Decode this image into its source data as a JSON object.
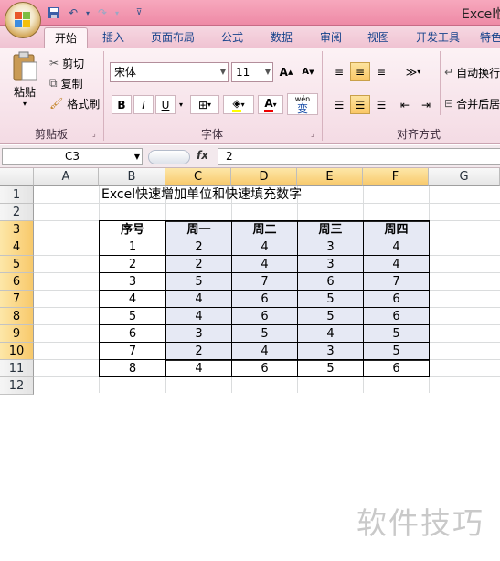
{
  "window": {
    "title": "Excel快"
  },
  "quick_access": {
    "icons": [
      "save-icon",
      "undo-icon",
      "redo-icon",
      "customize-icon"
    ]
  },
  "ribbon": {
    "tabs": [
      "开始",
      "插入",
      "页面布局",
      "公式",
      "数据",
      "审阅",
      "视图",
      "开发工具",
      "特色"
    ],
    "clipboard": {
      "paste": "粘贴",
      "cut": "剪切",
      "copy": "复制",
      "format_painter": "格式刷",
      "label": "剪贴板"
    },
    "font": {
      "name": "宋体",
      "size": "11",
      "label": "字体",
      "bold": "B",
      "italic": "I",
      "underline": "U",
      "grow": "A",
      "shrink": "A",
      "color": "A",
      "wen": "wén",
      "wen_char": "变"
    },
    "alignment": {
      "label": "对齐方式",
      "wrap": "自动换行",
      "merge": "合并后居"
    }
  },
  "formula_bar": {
    "name_box": "C3",
    "fx": "fx",
    "content": "2"
  },
  "grid": {
    "columns": [
      "A",
      "B",
      "C",
      "D",
      "E",
      "F",
      "G"
    ],
    "rows": [
      "1",
      "2",
      "3",
      "4",
      "5",
      "6",
      "7",
      "8",
      "9",
      "10",
      "11",
      "12"
    ],
    "title": "Excel快速增加单位和快速填充数字",
    "headers": [
      "序号",
      "周一",
      "周二",
      "周三",
      "周四"
    ],
    "data": [
      [
        "1",
        "2",
        "4",
        "3",
        "4"
      ],
      [
        "2",
        "2",
        "4",
        "3",
        "4"
      ],
      [
        "3",
        "5",
        "7",
        "6",
        "7"
      ],
      [
        "4",
        "4",
        "6",
        "5",
        "6"
      ],
      [
        "5",
        "4",
        "6",
        "5",
        "6"
      ],
      [
        "6",
        "3",
        "5",
        "4",
        "5"
      ],
      [
        "7",
        "2",
        "4",
        "3",
        "5"
      ],
      [
        "8",
        "4",
        "6",
        "5",
        "6"
      ]
    ]
  },
  "watermark": "软件技巧",
  "colors": {
    "titlebar": "#ee8aa6",
    "selection": "#e6e9f4",
    "header_selected": "#f8c96b"
  }
}
